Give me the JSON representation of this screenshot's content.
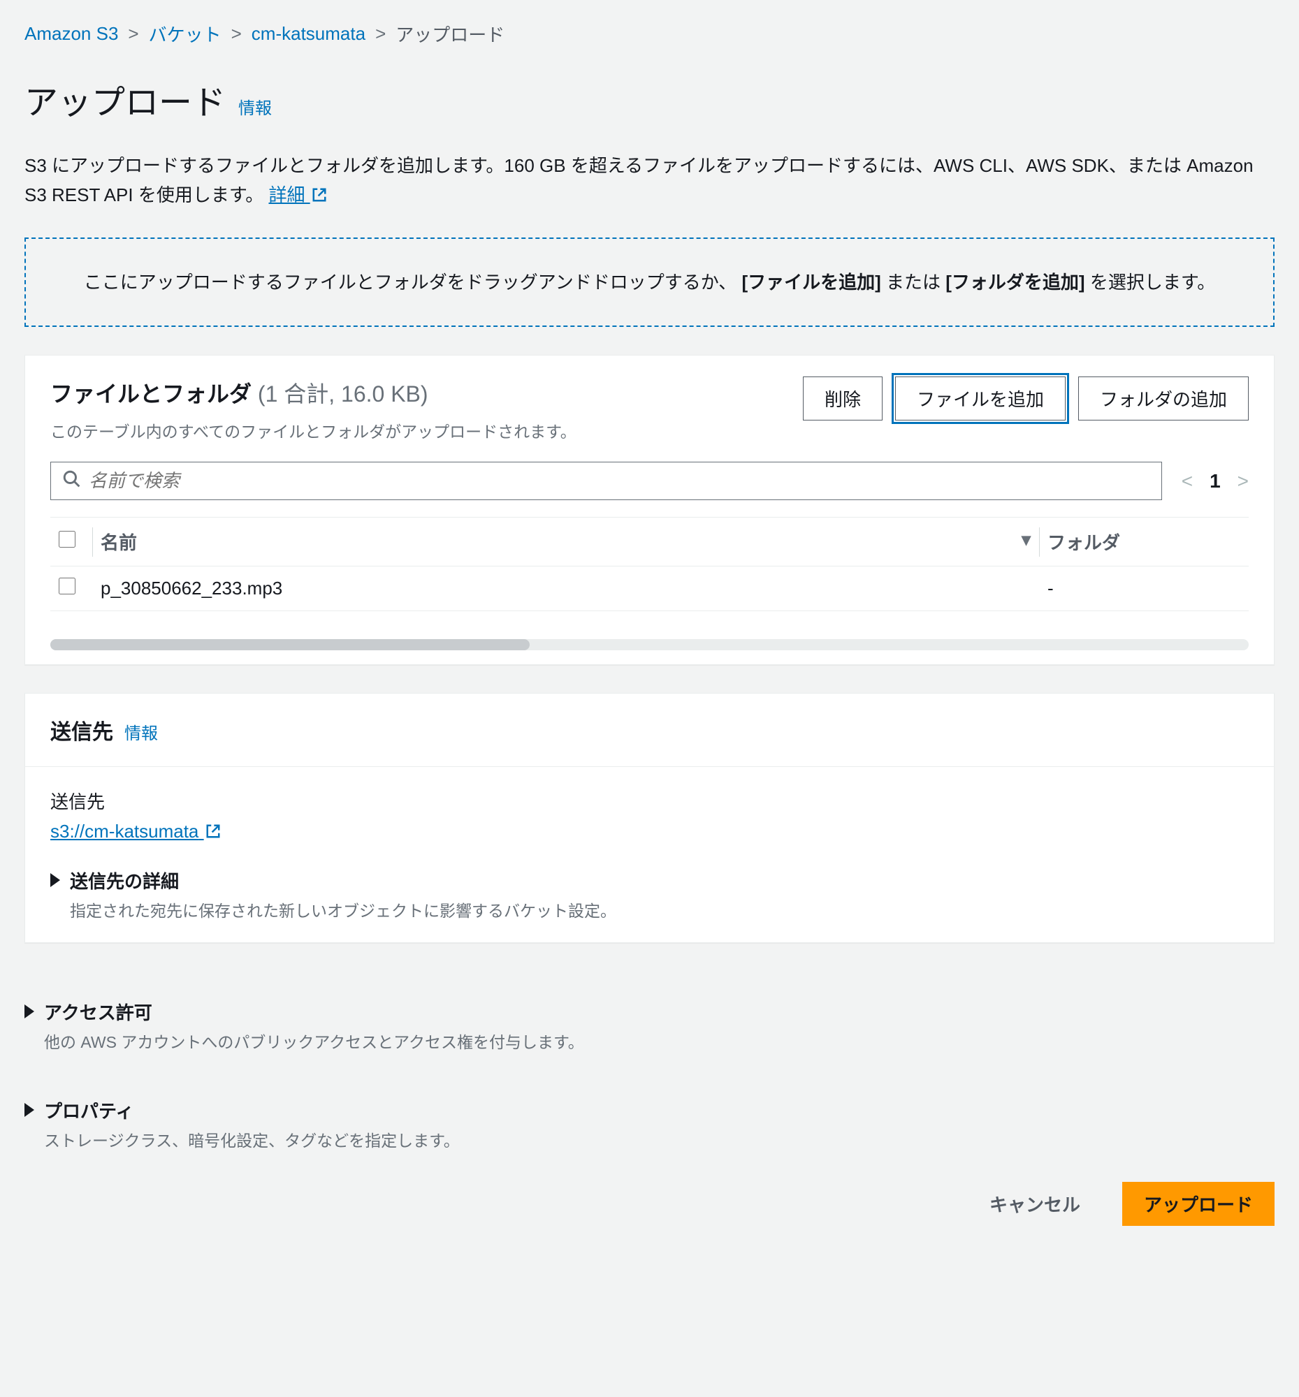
{
  "breadcrumb": {
    "items": [
      "Amazon S3",
      "バケット",
      "cm-katsumata"
    ],
    "current": "アップロード"
  },
  "page": {
    "title": "アップロード",
    "info": "情報",
    "desc_prefix": "S3 にアップロードするファイルとフォルダを追加します。160 GB を超えるファイルをアップロードするには、AWS CLI、AWS SDK、または Amazon S3 REST API を使用します。",
    "learn_more": "詳細"
  },
  "dropzone": {
    "prefix": "ここにアップロードするファイルとフォルダをドラッグアンドドロップするか、",
    "bold1": "[ファイルを追加]",
    "mid": " または ",
    "bold2": "[フォルダを追加]",
    "suffix": " を選択します。"
  },
  "files_panel": {
    "title": "ファイルとフォルダ",
    "count": "(1 合計, 16.0 KB)",
    "subdesc": "このテーブル内のすべてのファイルとフォルダがアップロードされます。",
    "delete_btn": "削除",
    "add_file_btn": "ファイルを追加",
    "add_folder_btn": "フォルダの追加",
    "search_placeholder": "名前で検索",
    "page": "1",
    "col_name": "名前",
    "col_folder": "フォルダ",
    "rows": [
      {
        "name": "p_30850662_233.mp3",
        "folder": "-"
      }
    ]
  },
  "destination": {
    "title": "送信先",
    "info": "情報",
    "label": "送信先",
    "uri": "s3://cm-katsumata",
    "detail_title": "送信先の詳細",
    "detail_desc": "指定された宛先に保存された新しいオブジェクトに影響するバケット設定。"
  },
  "access": {
    "title": "アクセス許可",
    "desc": "他の AWS アカウントへのパブリックアクセスとアクセス権を付与します。"
  },
  "properties": {
    "title": "プロパティ",
    "desc": "ストレージクラス、暗号化設定、タグなどを指定します。"
  },
  "footer": {
    "cancel": "キャンセル",
    "upload": "アップロード"
  }
}
